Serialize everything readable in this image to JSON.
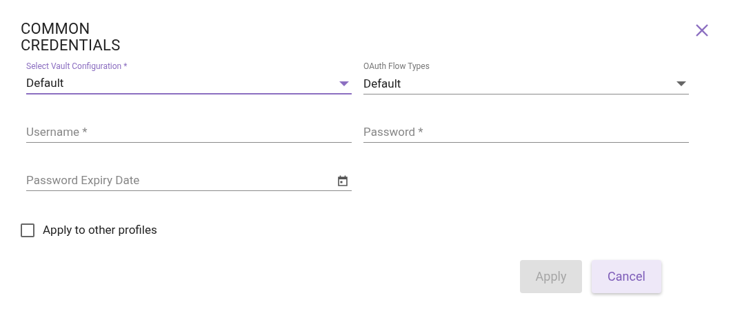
{
  "dialog": {
    "title": "COMMON\nCREDENTIALS",
    "fields": [
      {
        "kind": "select",
        "label": "Select Vault Configuration *",
        "value": "Default",
        "focused": true
      },
      {
        "kind": "select",
        "label": "OAuth Flow Types",
        "value": "Default",
        "focused": false
      },
      {
        "kind": "text",
        "placeholder": "Username *",
        "focused": false
      },
      {
        "kind": "text",
        "placeholder": "Password *",
        "focused": false
      },
      {
        "kind": "date",
        "placeholder": "Password Expiry Date",
        "focused": false
      }
    ],
    "checkbox": {
      "label": "Apply to other profiles",
      "checked": false
    },
    "buttons": [
      {
        "label": "Apply",
        "disabled": true
      },
      {
        "label": "Cancel",
        "disabled": false
      }
    ]
  }
}
